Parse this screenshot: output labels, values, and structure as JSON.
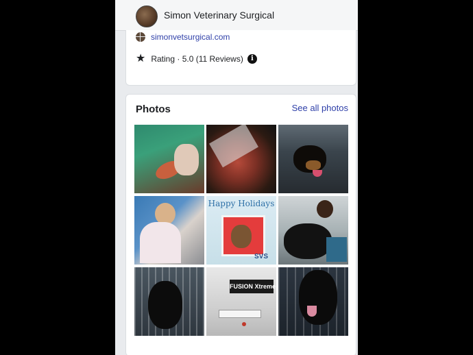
{
  "page": {
    "name": "Simon Veterinary Surgical",
    "website": "simonvetsurgical.com",
    "rating_text": "Rating · 5.0 (11 Reviews)",
    "info_symbol": "i"
  },
  "photos": {
    "title": "Photos",
    "see_all_label": "See all photos",
    "tiles": [
      {
        "caption": ""
      },
      {
        "caption": ""
      },
      {
        "caption": ""
      },
      {
        "caption": ""
      },
      {
        "caption": "Happy Holidays",
        "logo": "SVS"
      },
      {
        "caption": ""
      },
      {
        "caption": ""
      },
      {
        "caption": "FUSION Xtreme"
      },
      {
        "caption": ""
      }
    ]
  },
  "icons": {
    "website": "globe-icon",
    "rating": "star-icon",
    "info": "info-icon"
  },
  "colors": {
    "link": "#2e3fa8",
    "text": "#1c1e21",
    "card_bg": "#ffffff",
    "page_bg": "#e9ebee"
  }
}
